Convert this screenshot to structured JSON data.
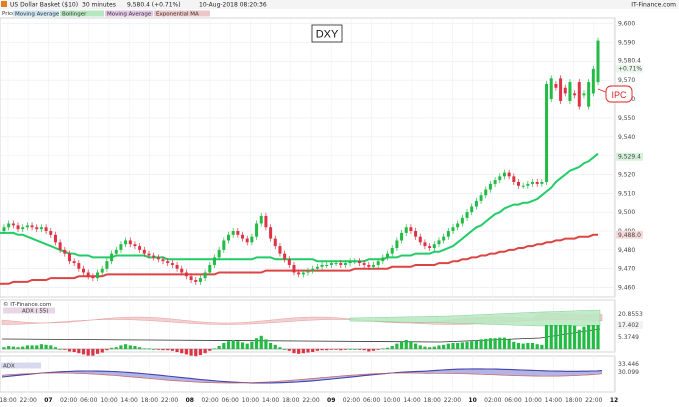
{
  "header": {
    "title": "US Dollar Basket ($10)",
    "interval": "30 minutes",
    "price": "9,580.4 (+0.71%)",
    "datetime": "10-Aug-2018 08:20:36",
    "brand": "IT-Finance.com"
  },
  "price_panel_label": "Price",
  "indicator_tags": [
    "Moving Average",
    "Bollinger",
    "Moving Average",
    "Exponential MA"
  ],
  "chart_label": "DXY",
  "callout": "IPC",
  "panel2": {
    "copyright": "© IT-Finance.com",
    "label": "ADX ( 55)",
    "right_values": [
      "20.8553",
      "17.402",
      "5.3749"
    ]
  },
  "panel3": {
    "label": "ADX",
    "right_values": [
      "33.446",
      "30.099"
    ]
  },
  "colors": {
    "up": "#22bb44",
    "down": "#dd3344",
    "ma_fast": "#22cc66",
    "ma_slow": "#dd4444",
    "adx_line": "#4444aa",
    "adx_fill": "#9999dd"
  },
  "chart_data": {
    "type": "candlestick",
    "y_axis_ticks": [
      "9,460",
      "9,470",
      "9,480",
      "9,490",
      "9,500",
      "9,510",
      "9,520",
      "9,530",
      "9,540",
      "9,550",
      "9,560",
      "9,570",
      "9,580",
      "9,590",
      "9,600"
    ],
    "y_range": [
      9455,
      9603
    ],
    "current_price_tag": "9,580.4",
    "current_change_tag": "+0.71%",
    "ma_fast_tag": "9,529.4",
    "ma_slow_tag": "9,488.0",
    "x_tick_labels": [
      "18:00",
      "22:00",
      "07",
      "02:00",
      "06:00",
      "10:00",
      "14:00",
      "18:00",
      "22:00",
      "08",
      "02:00",
      "06:00",
      "10:00",
      "14:00",
      "18:00",
      "22:00",
      "09",
      "02:00",
      "06:00",
      "10:00",
      "14:00",
      "18:00",
      "22:00",
      "10",
      "02:00",
      "06:00",
      "10:00",
      "14:00",
      "18:00",
      "22:00",
      "12"
    ],
    "x_major_labels": [
      "07",
      "08",
      "09",
      "10",
      "12"
    ],
    "closes": [
      9492,
      9494,
      9493,
      9491,
      9492,
      9493,
      9492,
      9491,
      9492,
      9490,
      9488,
      9484,
      9480,
      9478,
      9474,
      9473,
      9470,
      9468,
      9466,
      9465,
      9468,
      9470,
      9474,
      9478,
      9480,
      9483,
      9485,
      9483,
      9482,
      9480,
      9478,
      9477,
      9476,
      9475,
      9474,
      9473,
      9472,
      9470,
      9468,
      9466,
      9464,
      9463,
      9465,
      9468,
      9472,
      9476,
      9480,
      9485,
      9488,
      9490,
      9488,
      9486,
      9484,
      9487,
      9494,
      9498,
      9492,
      9486,
      9482,
      9478,
      9475,
      9472,
      9468,
      9467,
      9468,
      9469,
      9470,
      9471,
      9472,
      9472,
      9473,
      9473,
      9472,
      9473,
      9474,
      9474,
      9473,
      9472,
      9471,
      9472,
      9474,
      9476,
      9478,
      9481,
      9485,
      9489,
      9492,
      9490,
      9487,
      9484,
      9482,
      9481,
      9483,
      9485,
      9487,
      9490,
      9492,
      9494,
      9497,
      9500,
      9503,
      9506,
      9509,
      9512,
      9515,
      9517,
      9519,
      9521,
      9519,
      9516,
      9514,
      9514,
      9515,
      9516,
      9515,
      9516,
      9568,
      9571,
      9566,
      9559,
      9563,
      9569,
      9562,
      9556,
      9563,
      9569,
      9576,
      9591
    ],
    "opens": [
      9490,
      9492,
      9494,
      9493,
      9491,
      9492,
      9493,
      9492,
      9491,
      9492,
      9490,
      9488,
      9484,
      9480,
      9478,
      9474,
      9473,
      9470,
      9468,
      9466,
      9465,
      9468,
      9470,
      9474,
      9478,
      9480,
      9483,
      9485,
      9483,
      9482,
      9480,
      9478,
      9477,
      9476,
      9475,
      9474,
      9473,
      9472,
      9470,
      9468,
      9466,
      9464,
      9463,
      9465,
      9468,
      9472,
      9476,
      9480,
      9485,
      9488,
      9490,
      9488,
      9486,
      9484,
      9487,
      9494,
      9498,
      9492,
      9486,
      9482,
      9478,
      9475,
      9472,
      9468,
      9467,
      9468,
      9469,
      9470,
      9471,
      9472,
      9472,
      9473,
      9473,
      9472,
      9473,
      9474,
      9474,
      9473,
      9472,
      9471,
      9472,
      9474,
      9476,
      9478,
      9481,
      9485,
      9489,
      9492,
      9490,
      9487,
      9484,
      9482,
      9481,
      9483,
      9485,
      9487,
      9490,
      9492,
      9494,
      9497,
      9500,
      9503,
      9506,
      9509,
      9512,
      9515,
      9517,
      9519,
      9521,
      9519,
      9516,
      9514,
      9514,
      9515,
      9516,
      9515,
      9516,
      9560,
      9568,
      9571,
      9566,
      9559,
      9563,
      9569,
      9562,
      9556,
      9563,
      9569,
      9576
    ],
    "series": [
      {
        "name": "Moving Average (fast)",
        "values": [
          9489,
          9489,
          9489,
          9488,
          9488,
          9487,
          9486,
          9485,
          9484,
          9483,
          9482,
          9481,
          9480,
          9479,
          9478,
          9478,
          9477,
          9477,
          9477,
          9476,
          9476,
          9476,
          9476,
          9476,
          9477,
          9477,
          9477,
          9477,
          9477,
          9477,
          9477,
          9476,
          9476,
          9476,
          9476,
          9475,
          9475,
          9475,
          9475,
          9475,
          9475,
          9475,
          9475,
          9475,
          9475,
          9475,
          9475,
          9475,
          9475,
          9475,
          9475,
          9475,
          9475,
          9475,
          9476,
          9476,
          9476,
          9476,
          9475,
          9475,
          9475,
          9475,
          9475,
          9475,
          9475,
          9475,
          9475,
          9474,
          9474,
          9474,
          9474,
          9474,
          9474,
          9474,
          9474,
          9474,
          9474,
          9474,
          9475,
          9475,
          9475,
          9475,
          9476,
          9476,
          9476,
          9477,
          9477,
          9477,
          9478,
          9478,
          9478,
          9478,
          9479,
          9479,
          9480,
          9481,
          9482,
          9484,
          9486,
          9488,
          9490,
          9492,
          9493,
          9495,
          9497,
          9499,
          9500,
          9502,
          9503,
          9504,
          9504,
          9505,
          9505,
          9506,
          9507,
          9509,
          9511,
          9513,
          9516,
          9518,
          9520,
          9522,
          9523,
          9524,
          9526,
          9527,
          9529,
          9531
        ]
      },
      {
        "name": "Moving Average (slow)",
        "values": [
          9462,
          9462,
          9463,
          9463,
          9463,
          9463,
          9464,
          9464,
          9464,
          9464,
          9465,
          9465,
          9465,
          9465,
          9465,
          9465,
          9466,
          9466,
          9466,
          9466,
          9466,
          9466,
          9467,
          9467,
          9467,
          9467,
          9467,
          9467,
          9467,
          9467,
          9467,
          9467,
          9467,
          9467,
          9467,
          9467,
          9467,
          9467,
          9467,
          9467,
          9467,
          9467,
          9467,
          9467,
          9467,
          9467,
          9468,
          9468,
          9468,
          9468,
          9468,
          9468,
          9468,
          9468,
          9468,
          9468,
          9469,
          9469,
          9469,
          9469,
          9469,
          9469,
          9469,
          9469,
          9469,
          9469,
          9469,
          9469,
          9469,
          9469,
          9469,
          9469,
          9469,
          9469,
          9469,
          9470,
          9470,
          9470,
          9470,
          9470,
          9470,
          9470,
          9470,
          9471,
          9471,
          9471,
          9471,
          9471,
          9472,
          9472,
          9472,
          9472,
          9472,
          9473,
          9473,
          9473,
          9474,
          9474,
          9475,
          9475,
          9476,
          9476,
          9477,
          9477,
          9478,
          9478,
          9479,
          9479,
          9480,
          9480,
          9481,
          9481,
          9482,
          9482,
          9483,
          9483,
          9484,
          9484,
          9485,
          9485,
          9486,
          9486,
          9486,
          9487,
          9487,
          9487,
          9488,
          9488
        ]
      }
    ]
  }
}
